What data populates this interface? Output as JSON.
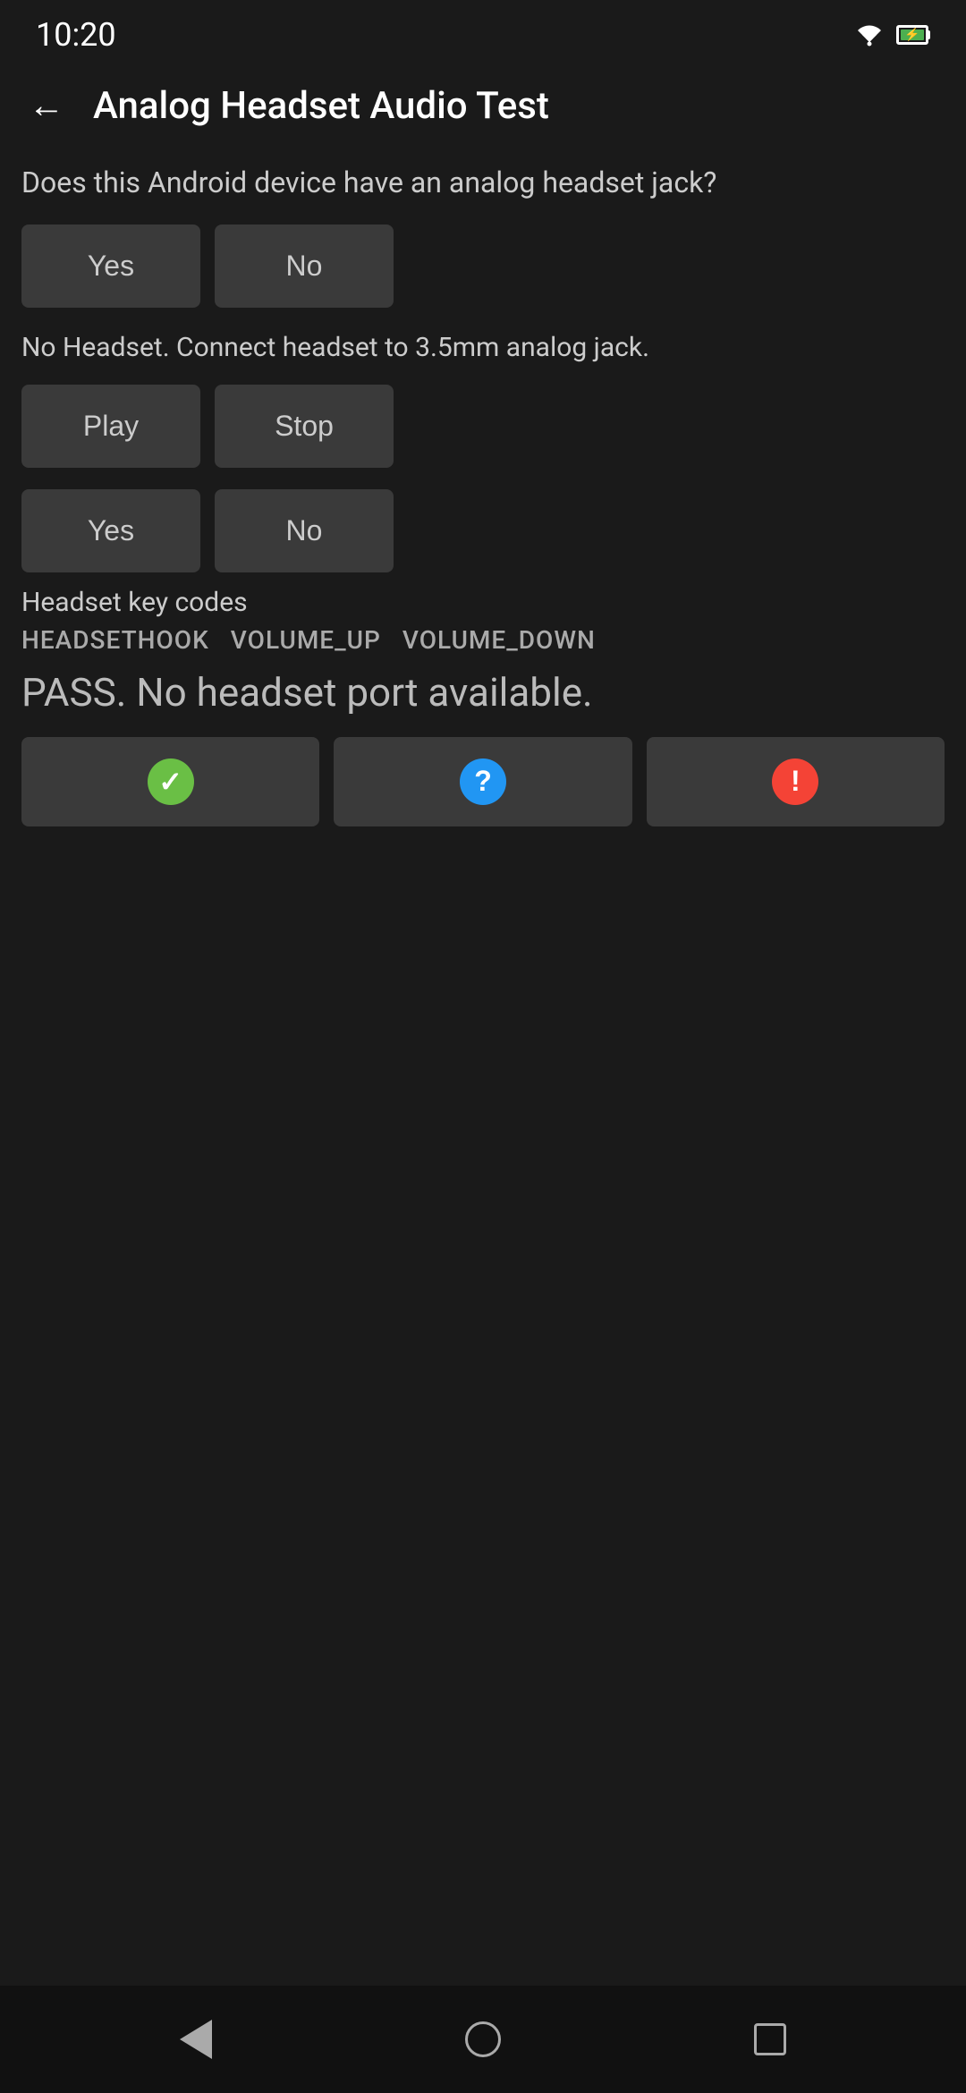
{
  "statusBar": {
    "time": "10:20"
  },
  "header": {
    "backLabel": "←",
    "title": "Analog Headset Audio Test"
  },
  "section1": {
    "question": "Does this Android device have an analog headset jack?",
    "yesLabel": "Yes",
    "noLabel": "No"
  },
  "section2": {
    "infoText": "No Headset. Connect headset to 3.5mm analog jack.",
    "playLabel": "Play",
    "stopLabel": "Stop"
  },
  "section3": {
    "yesLabel": "Yes",
    "noLabel": "No"
  },
  "keyCodes": {
    "label": "Headset key codes",
    "items": [
      "HEADSETHOOK",
      "VOLUME_UP",
      "VOLUME_DOWN"
    ]
  },
  "passText": "PASS. No headset port available.",
  "resultButtons": {
    "passIcon": "✓",
    "questionIcon": "?",
    "failIcon": "!"
  },
  "navBar": {
    "backAriaLabel": "back",
    "homeAriaLabel": "home",
    "recentsAriaLabel": "recents"
  }
}
